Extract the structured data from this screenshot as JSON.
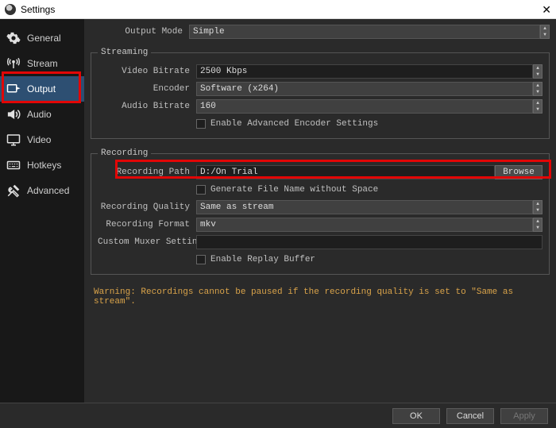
{
  "window": {
    "title": "Settings"
  },
  "sidebar": {
    "items": [
      {
        "label": "General"
      },
      {
        "label": "Stream"
      },
      {
        "label": "Output"
      },
      {
        "label": "Audio"
      },
      {
        "label": "Video"
      },
      {
        "label": "Hotkeys"
      },
      {
        "label": "Advanced"
      }
    ]
  },
  "top": {
    "output_mode_label": "Output Mode",
    "output_mode_value": "Simple"
  },
  "streaming": {
    "legend": "Streaming",
    "video_bitrate_label": "Video Bitrate",
    "video_bitrate_value": "2500 Kbps",
    "encoder_label": "Encoder",
    "encoder_value": "Software (x264)",
    "audio_bitrate_label": "Audio Bitrate",
    "audio_bitrate_value": "160",
    "enable_advanced_label": "Enable Advanced Encoder Settings"
  },
  "recording": {
    "legend": "Recording",
    "path_label": "Recording Path",
    "path_value": "D:/On Trial",
    "browse_label": "Browse",
    "no_space_label": "Generate File Name without Space",
    "quality_label": "Recording Quality",
    "quality_value": "Same as stream",
    "format_label": "Recording Format",
    "format_value": "mkv",
    "custom_muxer_label": "Custom Muxer Settings",
    "custom_muxer_value": "",
    "replay_buffer_label": "Enable Replay Buffer"
  },
  "warning_text": "Warning: Recordings cannot be paused if the recording quality is set to \"Same as stream\".",
  "buttons": {
    "ok": "OK",
    "cancel": "Cancel",
    "apply": "Apply"
  }
}
